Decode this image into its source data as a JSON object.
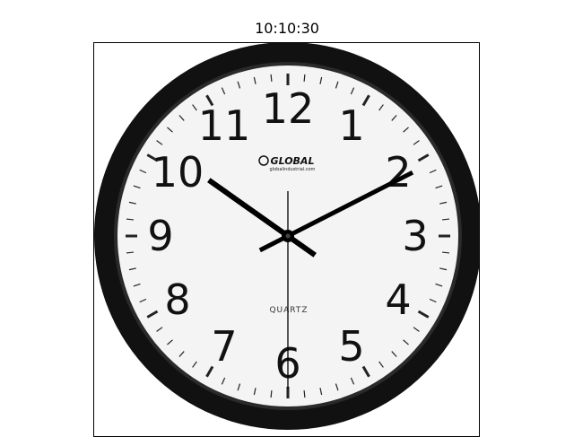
{
  "title": "10:10:30",
  "clock": {
    "numerals": [
      "12",
      "1",
      "2",
      "3",
      "4",
      "5",
      "6",
      "7",
      "8",
      "9",
      "10",
      "11"
    ],
    "brand": "GLOBAL",
    "brand_url": "globalindustrial.com",
    "movement_label": "QUARTZ",
    "time": {
      "hours": 10,
      "minutes": 10,
      "seconds": 30
    }
  },
  "colors": {
    "bezel": "#111111",
    "bezel_inner": "#2a2a2a",
    "dial": "#f4f4f4",
    "hands": "#000000",
    "ticks": "#222222"
  }
}
